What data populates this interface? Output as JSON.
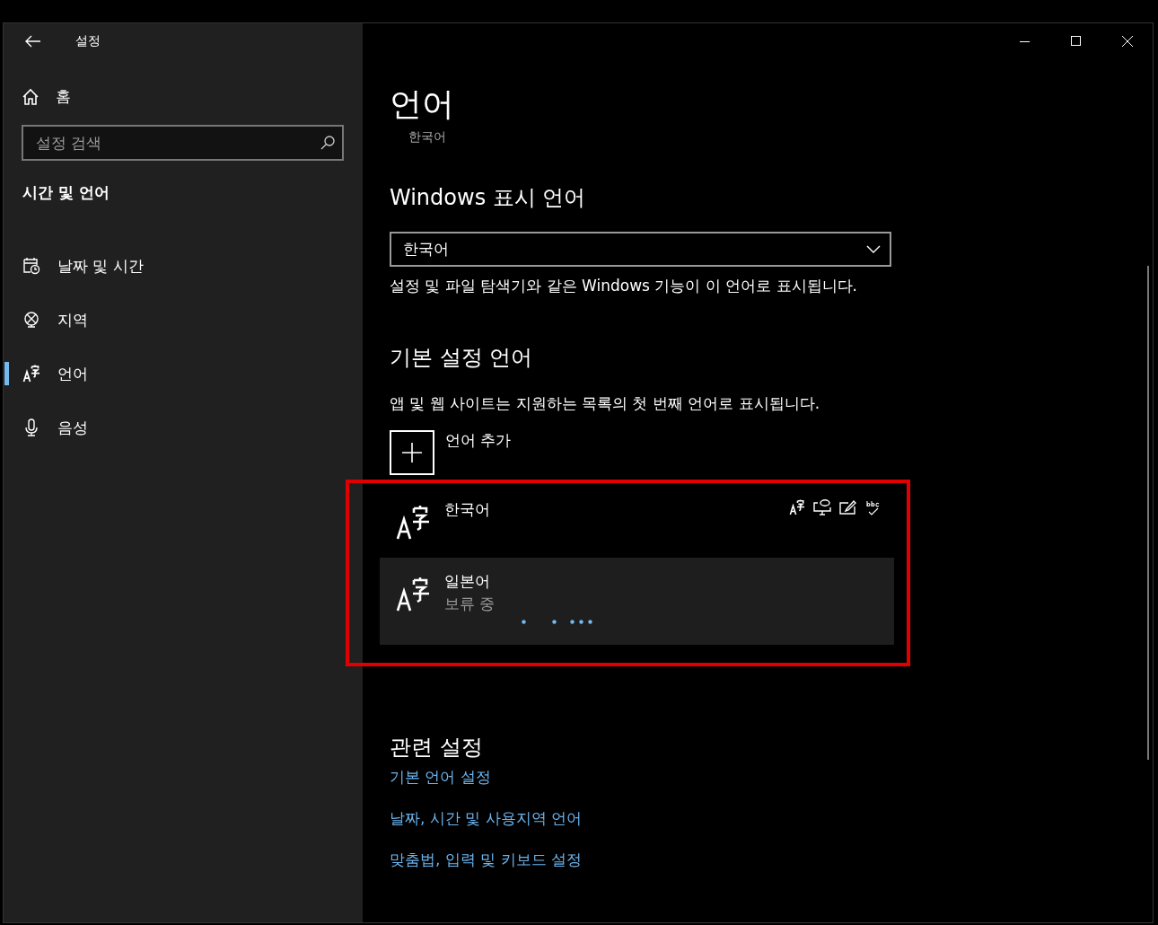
{
  "window": {
    "title": "설정"
  },
  "sidebar": {
    "home": "홈",
    "search": {
      "placeholder": "설정 검색"
    },
    "section": "시간 및 언어",
    "items": [
      {
        "label": "날짜 및 시간",
        "selected": false
      },
      {
        "label": "지역",
        "selected": false
      },
      {
        "label": "언어",
        "selected": true
      },
      {
        "label": "음성",
        "selected": false
      }
    ]
  },
  "page": {
    "title": "언어",
    "subtitle": "한국어",
    "display_language": {
      "heading": "Windows 표시 언어",
      "value": "한국어",
      "description": "설정 및 파일 탐색기와 같은 Windows 기능이 이 언어로 표시됩니다."
    },
    "preferred": {
      "heading": "기본 설정 언어",
      "description": "앱 및 웹 사이트는 지원하는 목록의 첫 번째 언어로 표시됩니다.",
      "add_label": "언어 추가",
      "highlighted": true,
      "languages": [
        {
          "name": "한국어",
          "selected": false,
          "features": true,
          "busy": false
        },
        {
          "name": "일본어",
          "status": "보류 중",
          "selected": true,
          "features": false,
          "busy": true
        }
      ]
    },
    "related": {
      "heading": "관련 설정",
      "links": [
        "기본 언어 설정",
        "날짜, 시간 및 사용지역 언어",
        "맞춤법, 입력 및 키보드 설정"
      ]
    }
  }
}
